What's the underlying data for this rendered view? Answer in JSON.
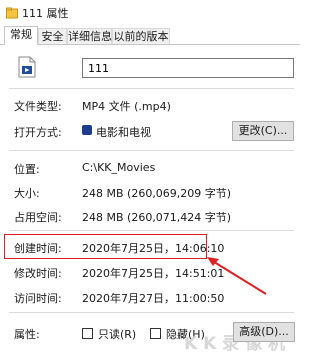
{
  "window": {
    "title": "111 属性"
  },
  "tabs": [
    {
      "label": "常规",
      "active": true
    },
    {
      "label": "安全",
      "active": false
    },
    {
      "label": "详细信息",
      "active": false
    },
    {
      "label": "以前的版本",
      "active": false
    }
  ],
  "file": {
    "name": "111",
    "icon": "video-file-icon"
  },
  "properties": {
    "type_label": "文件类型:",
    "type_value": "MP4 文件 (.mp4)",
    "opens_label": "打开方式:",
    "opens_value": "电影和电视",
    "change_button": "更改(C)...",
    "location_label": "位置:",
    "location_value": "C:\\KK_Movies",
    "size_label": "大小:",
    "size_value": "248 MB (260,069,209 字节)",
    "disk_size_label": "占用空间:",
    "disk_size_value": "248 MB (260,071,424 字节)",
    "created_label": "创建时间:",
    "created_value": "2020年7月25日，14:06:10",
    "modified_label": "修改时间:",
    "modified_value": "2020年7月25日，14:51:01",
    "accessed_label": "访问时间:",
    "accessed_value": "2020年7月27日，11:00:50",
    "attributes_label": "属性:",
    "readonly_label": "只读(R)",
    "hidden_label": "隐藏(H)",
    "advanced_button": "高级(D)..."
  },
  "annotation": {
    "color": "#e02020"
  },
  "watermark": {
    "text": "KK录像机"
  }
}
